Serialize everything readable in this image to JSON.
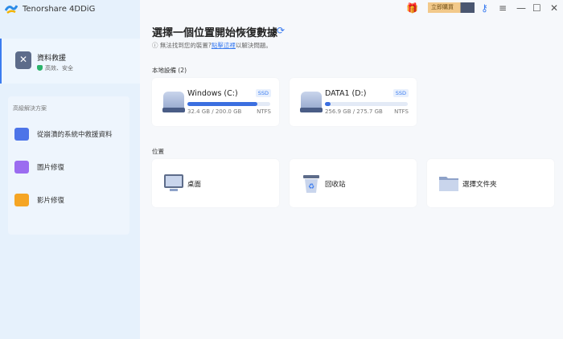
{
  "app": {
    "title": "Tenorshare 4DDiG"
  },
  "titlebar": {
    "buy_label": "立即購買"
  },
  "sidebar": {
    "main_item": {
      "label": "資料救援",
      "sub": "高效、安全"
    },
    "advanced": {
      "heading": "高級解決方案",
      "items": [
        {
          "label": "從崩潰的系統中救援資料"
        },
        {
          "label": "圖片修復"
        },
        {
          "label": "影片修復"
        }
      ]
    }
  },
  "main": {
    "title": "選擇一個位置開始恢復數據",
    "hint_prefix": "無法找到您的裝置?",
    "hint_link": "點擊這裡",
    "hint_suffix": "以解決問題。",
    "local_heading": "本地設備 (2)",
    "drives": [
      {
        "name": "Windows (C:)",
        "type": "SSD",
        "size": "32.4 GB / 200.0 GB",
        "fs": "NTFS",
        "used_fraction": 0.84
      },
      {
        "name": "DATA1 (D:)",
        "type": "SSD",
        "size": "256.9 GB / 275.7 GB",
        "fs": "NTFS",
        "used_fraction": 0.07
      }
    ],
    "location_heading": "位置",
    "locations": [
      {
        "label": "桌面"
      },
      {
        "label": "回收站"
      },
      {
        "label": "選擇文件夾"
      }
    ]
  },
  "colors": {
    "accent": "#3b7cf0",
    "sidebar": "#e6f1fc"
  }
}
